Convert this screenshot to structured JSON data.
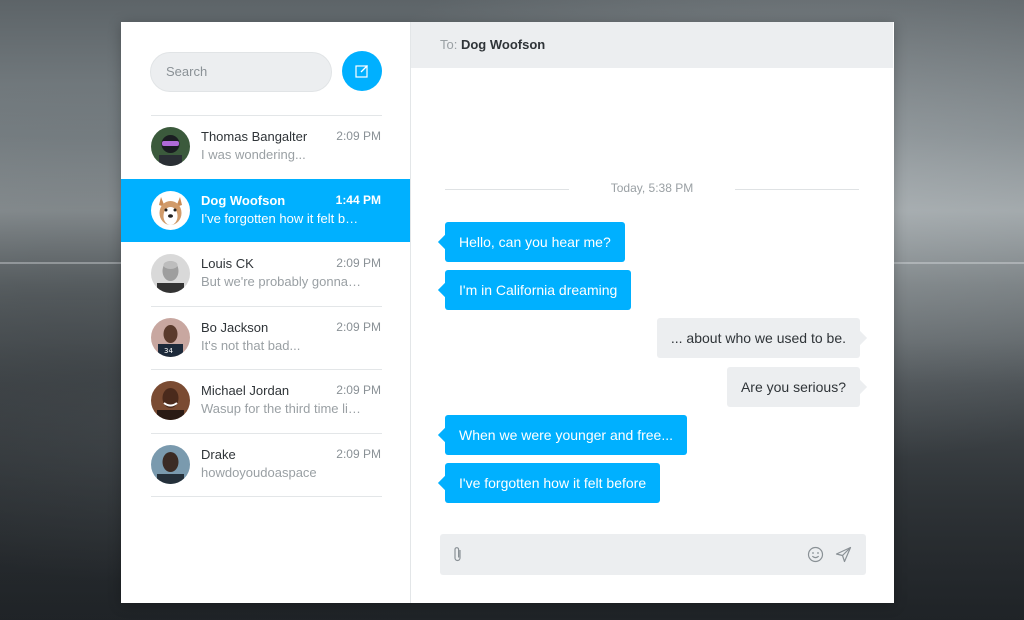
{
  "search": {
    "placeholder": "Search"
  },
  "contacts": [
    {
      "name": "Thomas Bangalter",
      "time": "2:09 PM",
      "preview": "I was wondering...",
      "active": false
    },
    {
      "name": "Dog Woofson",
      "time": "1:44 PM",
      "preview": "I've forgotten how it felt before",
      "active": true
    },
    {
      "name": "Louis CK",
      "time": "2:09 PM",
      "preview": "But we're probably gonna need a new carpet.",
      "active": false
    },
    {
      "name": "Bo Jackson",
      "time": "2:09 PM",
      "preview": "It's not that bad...",
      "active": false
    },
    {
      "name": "Michael Jordan",
      "time": "2:09 PM",
      "preview": "Wasup for the third time like is",
      "active": false
    },
    {
      "name": "Drake",
      "time": "2:09 PM",
      "preview": "howdoyoudoaspace",
      "active": false
    }
  ],
  "chat": {
    "to_label": "To: ",
    "to_name": "Dog Woofson",
    "day_label": "Today, 5:38 PM",
    "messages": [
      {
        "from": "you",
        "text": "Hello, can you hear me?"
      },
      {
        "from": "you",
        "text": "I'm in California dreaming"
      },
      {
        "from": "me",
        "text": "... about who we used to be."
      },
      {
        "from": "me",
        "text": "Are you serious?"
      },
      {
        "from": "you",
        "text": "When we were younger and free..."
      },
      {
        "from": "you",
        "text": "I've forgotten how it felt before"
      }
    ]
  },
  "colors": {
    "accent": "#00b0ff",
    "bubble_me": "#eceef0",
    "header_bg": "#eceef0"
  },
  "icons": {
    "compose": "compose-icon",
    "attach": "paperclip-icon",
    "emoji": "smiley-icon",
    "send": "send-icon"
  }
}
